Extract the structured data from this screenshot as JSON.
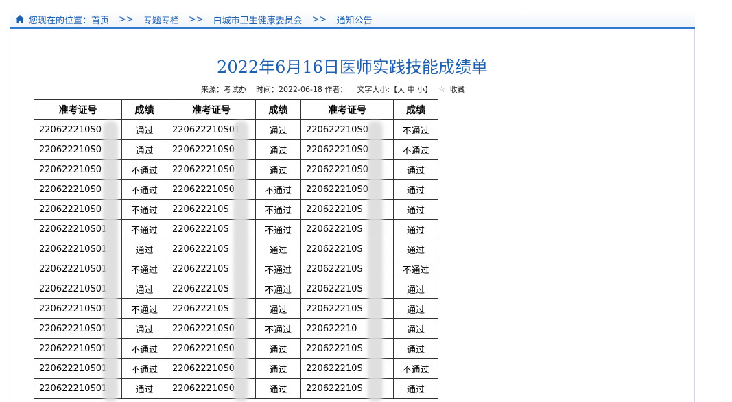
{
  "breadcrumb": {
    "prefix": "您现在的位置：",
    "items": [
      "首页",
      "专题专栏",
      "白城市卫生健康委员会",
      "通知公告"
    ],
    "separator": ">>"
  },
  "article": {
    "title": "2022年6月16日医师实践技能成绩单",
    "source_label": "来源：考试办",
    "time_label": "时间：2022-06-18 作者：",
    "font_size_label": "文字大小:【大 中 小】",
    "favorite_label": "收藏"
  },
  "table": {
    "headers": [
      "准考证号",
      "成绩",
      "准考证号",
      "成绩",
      "准考证号",
      "成绩"
    ],
    "rows": [
      [
        "220622210S0",
        "通过",
        "220622210S01",
        "通过",
        "220622210S0",
        "不通过"
      ],
      [
        "220622210S0",
        "通过",
        "220622210S0",
        "通过",
        "220622210S0",
        "不通过"
      ],
      [
        "220622210S0",
        "不通过",
        "220622210S0",
        "通过",
        "220622210S0",
        "通过"
      ],
      [
        "220622210S0",
        "不通过",
        "220622210S0",
        "不通过",
        "220622210S0",
        "通过"
      ],
      [
        "220622210S0",
        "不通过",
        "220622210S",
        "不通过",
        "220622210S",
        "通过"
      ],
      [
        "220622210S01",
        "不通过",
        "220622210S",
        "不通过",
        "220622210S",
        "通过"
      ],
      [
        "220622210S01",
        "通过",
        "220622210S",
        "通过",
        "220622210S",
        "通过"
      ],
      [
        "220622210S01",
        "不通过",
        "220622210S",
        "不通过",
        "220622210S",
        "不通过"
      ],
      [
        "220622210S01",
        "通过",
        "220622210S",
        "不通过",
        "220622210S",
        "通过"
      ],
      [
        "220622210S01",
        "不通过",
        "220622210S",
        "通过",
        "220622210S",
        "通过"
      ],
      [
        "220622210S01",
        "通过",
        "220622210S0",
        "不通过",
        "220622210",
        "通过"
      ],
      [
        "220622210S01",
        "不通过",
        "220622210S0",
        "通过",
        "220622210S",
        "通过"
      ],
      [
        "220622210S01",
        "不通过",
        "220622210S0",
        "通过",
        "220622210S",
        "不通过"
      ],
      [
        "220622210S01",
        "通过",
        "220622210S0",
        "通过",
        "220622210S",
        "通过"
      ]
    ]
  },
  "colors": {
    "link": "#1f5fae",
    "accent_line": "#2f7bd0"
  }
}
